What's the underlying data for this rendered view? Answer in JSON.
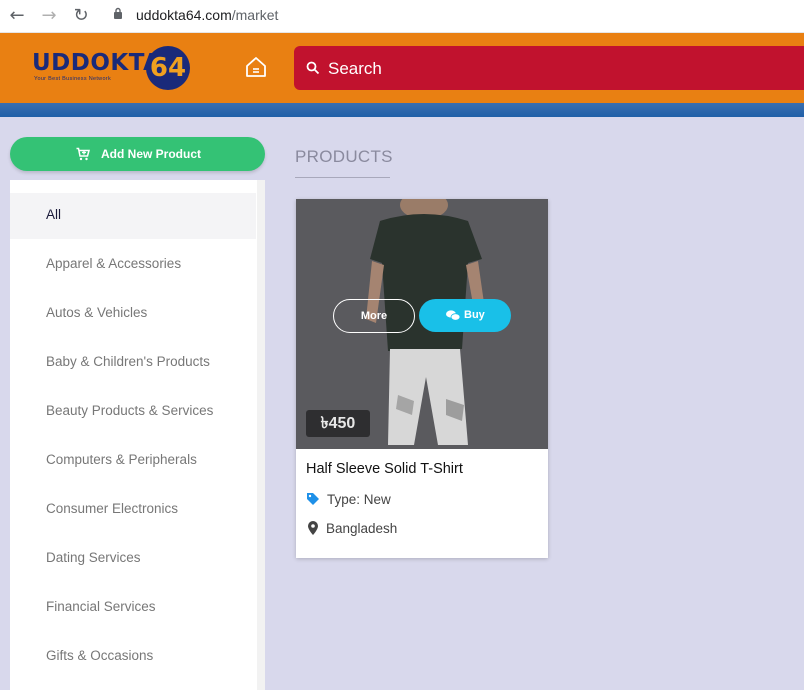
{
  "browser": {
    "url_domain": "uddokta64.com",
    "url_path": "/market"
  },
  "header": {
    "logo_text": "UDDOKTA",
    "logo_number": "64",
    "logo_tagline": "Your Best Business Network",
    "search_label": "Search",
    "brand_color": "#e98012",
    "search_color": "#c1122e"
  },
  "sidebar": {
    "add_button_label": "Add New Product",
    "categories": [
      {
        "label": "All",
        "active": true
      },
      {
        "label": "Apparel & Accessories"
      },
      {
        "label": "Autos & Vehicles"
      },
      {
        "label": "Baby & Children's Products"
      },
      {
        "label": "Beauty Products & Services"
      },
      {
        "label": "Computers & Peripherals"
      },
      {
        "label": "Consumer Electronics"
      },
      {
        "label": "Dating Services"
      },
      {
        "label": "Financial Services"
      },
      {
        "label": "Gifts & Occasions"
      }
    ]
  },
  "main": {
    "section_title": "PRODUCTS",
    "products": [
      {
        "title": "Half Sleeve Solid T-Shirt",
        "price": "৳450",
        "type": "Type: New",
        "location": "Bangladesh",
        "more_label": "More",
        "buy_label": "Buy"
      }
    ]
  }
}
